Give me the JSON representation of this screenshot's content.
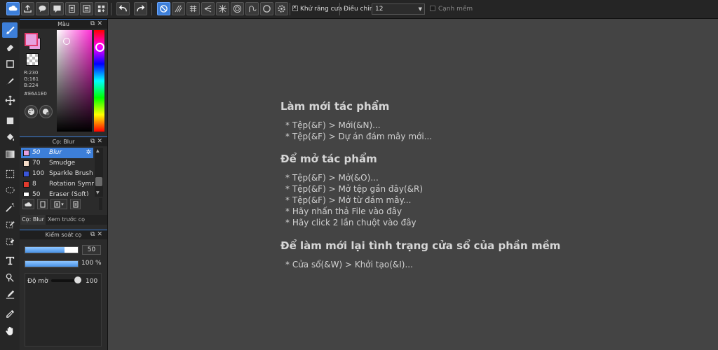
{
  "toolbar": {
    "antialias_label": "Khử răng cưa",
    "stabilizer_label": "Điều chỉnh",
    "stabilizer_value": "12",
    "soft_edge_label": "Cạnh mềm"
  },
  "color_panel": {
    "title": "Màu",
    "r": "R:230",
    "g": "G:161",
    "b": "B:224",
    "hex": "#E6A1E0",
    "foreground_color": "#E6A1E0"
  },
  "brush_panel": {
    "title": "Cọ: Blur",
    "brushes": [
      {
        "size": "50",
        "name": "Blur",
        "color": "#e6a1e0"
      },
      {
        "size": "70",
        "name": "Smudge",
        "color": "#f5ddc8"
      },
      {
        "size": "100",
        "name": "Sparkle Brush",
        "color": "#3a56d9"
      },
      {
        "size": "8",
        "name": "Rotation Symm",
        "color": "#e23b2e"
      },
      {
        "size": "50",
        "name": "Eraser (Soft)",
        "color": "#ffffff"
      }
    ],
    "tab_brush": "Cọ: Blur",
    "tab_preview": "Xem trước cọ"
  },
  "brush_control": {
    "title": "Kiểm soát cọ",
    "size_value": "50",
    "opacity_value": "100 %",
    "density_label": "Độ mờ",
    "density_value": "100"
  },
  "welcome": {
    "new_heading": "Làm mới tác phẩm",
    "new_items": [
      "* Tệp(&F) > Mới(&N)...",
      "* Tệp(&F) > Dự án đám mây mới..."
    ],
    "open_heading": "Để mở tác phẩm",
    "open_items": [
      "* Tệp(&F) > Mở(&O)...",
      "* Tệp(&F) > Mở tệp gần đây(&R)",
      "* Tệp(&F) > Mở từ đám mây...",
      "* Hãy nhấn thả File vào đây",
      "* Hãy click 2 lần chuột vào đây"
    ],
    "reset_heading": "Để làm mới lại tình trạng cửa sổ của phần mềm",
    "reset_items": [
      "* Cửa sổ(&W) > Khởi tạo(&I)..."
    ]
  }
}
